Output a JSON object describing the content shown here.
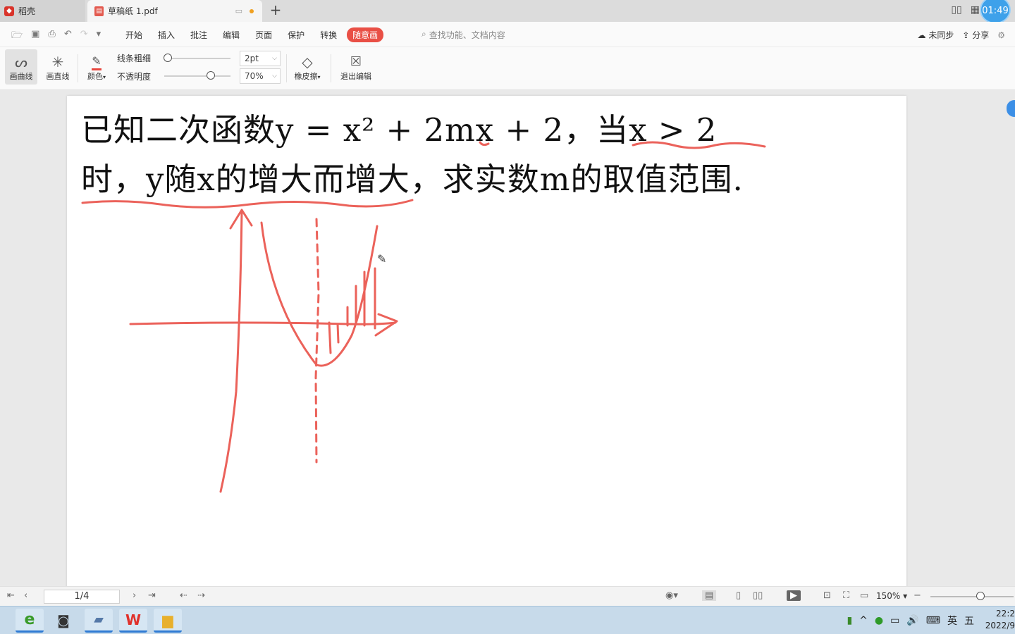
{
  "tabs": [
    {
      "label": "稻壳",
      "icon": "docer-logo-icon",
      "active": false
    },
    {
      "label": "草稿纸 1.pdf",
      "icon": "pdf-file-icon",
      "active": true
    }
  ],
  "new_tab_label": "+",
  "clock_badge": "01:49",
  "menu": {
    "items": [
      "开始",
      "插入",
      "批注",
      "编辑",
      "页面",
      "保护",
      "转换",
      "随意画"
    ],
    "active": "随意画",
    "search_placeholder": "查找功能、文档内容",
    "sync_label": "未同步",
    "share_label": "分享"
  },
  "draw_toolbar": {
    "curve_label": "画曲线",
    "straight_label": "画直线",
    "color_label": "颜色",
    "color_value": "#e8473e",
    "line_width_label": "线条粗细",
    "line_width_value": "2pt",
    "line_width_level": 0.05,
    "opacity_label": "不透明度",
    "opacity_value": "70%",
    "opacity_level": 0.7,
    "eraser_label": "橡皮擦",
    "exit_label": "退出编辑"
  },
  "document": {
    "line1": "已知二次函数y = x² + 2mx + 2，当x > 2",
    "line2": "时，y随x的增大而增大，求实数m的取值范围.",
    "ink_color": "#e8473e"
  },
  "status": {
    "page_indicator": "1/4",
    "zoom": "150%"
  },
  "taskbar": {
    "apps": [
      "ie-browser-icon",
      "camera-icon",
      "network-drive-icon",
      "wps-office-icon",
      "file-explorer-icon"
    ],
    "ime_label": "英",
    "ime_mode": "五",
    "time": "22:2",
    "date": "2022/9"
  }
}
